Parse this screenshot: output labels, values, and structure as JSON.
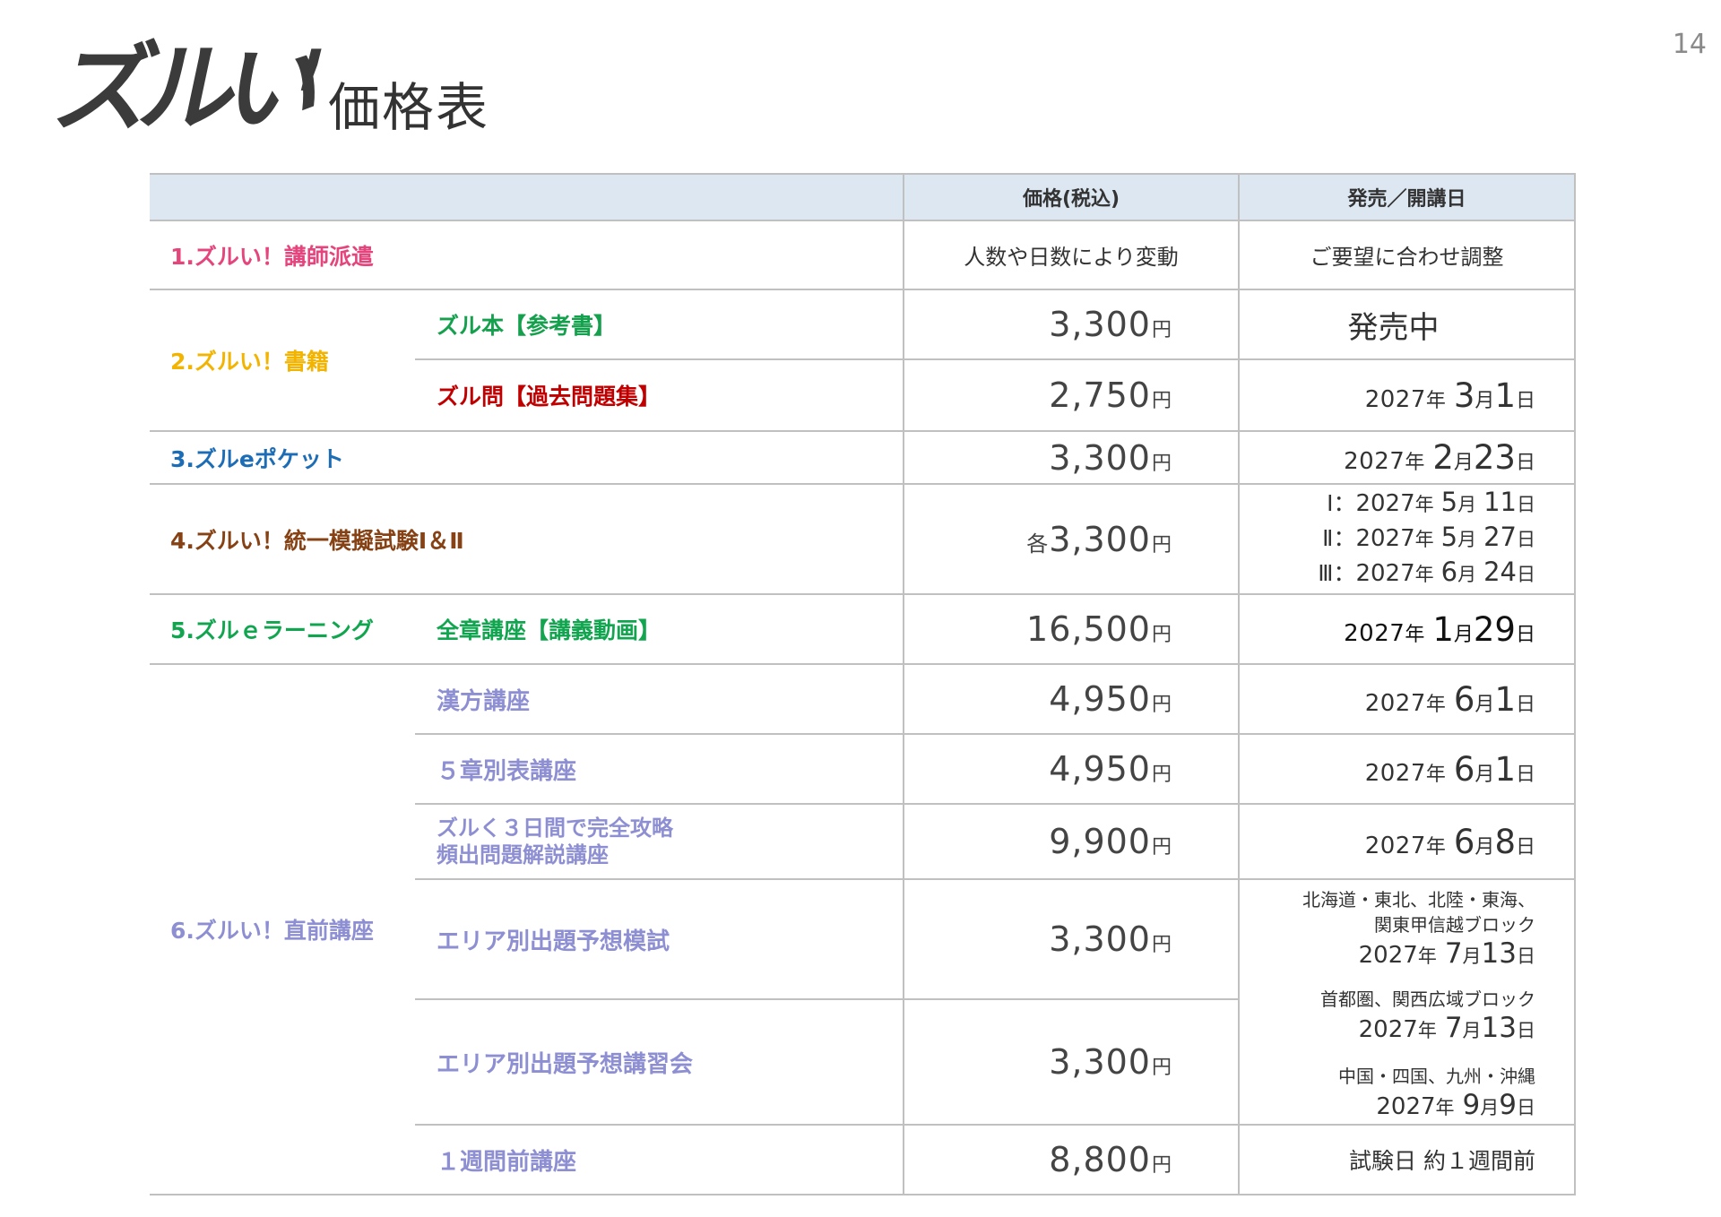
{
  "page_number": "14",
  "logo": {
    "text": "ズルい",
    "mark": "!"
  },
  "title": "価格表",
  "units": {
    "yen": "円",
    "year": "年",
    "month": "月",
    "day": "日"
  },
  "colors": {
    "header_bg": "#dce7f2",
    "c_r1": "#e4457c",
    "c_r2": "#f2b400",
    "c_r2_0": "#14a04c",
    "c_r2_1": "#c00000",
    "c_r3": "#1c6db5",
    "c_r4": "#864214",
    "c_r5": "#12a54f",
    "c_r6": "#8d8fd2"
  },
  "header": {
    "price": "価格(税込)",
    "date": "発売／開講日"
  },
  "rows": {
    "r1": {
      "label": "1.ズルい！講師派遣",
      "price_text": "人数や日数により変動",
      "date_text": "ご要望に合わせ調整"
    },
    "r2": {
      "label": "2.ズルい！書籍",
      "items": [
        {
          "name": "ズル本【参考書】",
          "price": "3,300",
          "date_text": "発売中"
        },
        {
          "name": "ズル問【過去問題集】",
          "price": "2,750",
          "date": {
            "y": "2027",
            "m": "3",
            "d": "1"
          }
        }
      ]
    },
    "r3": {
      "label": "3.ズルeポケット",
      "price": "3,300",
      "date": {
        "y": "2027",
        "m": "2",
        "d": "23"
      }
    },
    "r4": {
      "label": "4.ズルい！統一模擬試験Ⅰ＆Ⅱ",
      "price_prefix": "各",
      "price": "3,300",
      "dates": [
        {
          "prefix": "Ⅰ：",
          "y": "2027",
          "m": "5",
          "d": "11"
        },
        {
          "prefix": "Ⅱ：",
          "y": "2027",
          "m": "5",
          "d": "27"
        },
        {
          "prefix": "Ⅲ：",
          "y": "2027",
          "m": "6",
          "d": "24"
        }
      ]
    },
    "r5": {
      "label": "5.ズルｅラーニング",
      "items": [
        {
          "name": "全章講座【講義動画】",
          "price": "16,500",
          "date": {
            "y": "2027",
            "m": "1",
            "d": "29"
          }
        }
      ]
    },
    "r6": {
      "label": "6.ズルい！直前講座",
      "items": [
        {
          "name": "漢方講座",
          "price": "4,950",
          "date": {
            "y": "2027",
            "m": "6",
            "d": "1"
          }
        },
        {
          "name": "５章別表講座",
          "price": "4,950",
          "date": {
            "y": "2027",
            "m": "6",
            "d": "1"
          }
        },
        {
          "name_lines": [
            "ズルく３日間で完全攻略",
            "頻出問題解説講座"
          ],
          "price": "9,900",
          "date": {
            "y": "2027",
            "m": "6",
            "d": "8"
          }
        },
        {
          "name": "エリア別出題予想模試",
          "price": "3,300"
        },
        {
          "name": "エリア別出題予想講習会",
          "price": "3,300"
        },
        {
          "name": "１週間前講座",
          "price": "8,800",
          "date_text": "試験日 約１週間前"
        }
      ],
      "area_schedule": [
        {
          "region_lines": [
            "北海道・東北、北陸・東海、",
            "関東甲信越ブロック"
          ],
          "date": {
            "y": "2027",
            "m": "7",
            "d": "13"
          }
        },
        {
          "region_lines": [
            "首都圏、関西広域ブロック"
          ],
          "date": {
            "y": "2027",
            "m": "7",
            "d": "13"
          }
        },
        {
          "region_lines": [
            "中国・四国、九州・沖縄"
          ],
          "date": {
            "y": "2027",
            "m": "9",
            "d": "9"
          }
        }
      ]
    }
  }
}
